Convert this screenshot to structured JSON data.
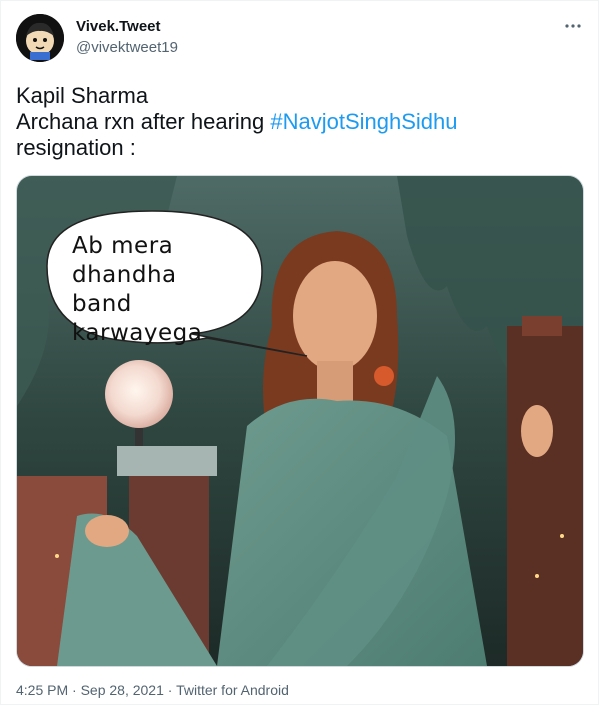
{
  "author": {
    "display_name": "Vivek.Tweet",
    "handle": "@vivektweet19"
  },
  "tweet": {
    "line1": "Kapil Sharma",
    "line2_prefix": "Archana rxn after hearing ",
    "hashtag": "#NavjotSinghSidhu",
    "line3": "resignation :"
  },
  "media": {
    "speech_bubble": {
      "line1": "Ab mera",
      "line2": "dhandha",
      "line3": "band",
      "line4": "karwayega"
    }
  },
  "footer": {
    "meta": "4:25 PM · Sep 28, 2021 · Twitter for Android"
  },
  "icons": {
    "more": "more-horizontal-icon",
    "avatar": "avatar-cartoon"
  },
  "colors": {
    "hashtag": "#1d9bf0",
    "secondary_text": "#536471",
    "primary_text": "#0f1419"
  }
}
